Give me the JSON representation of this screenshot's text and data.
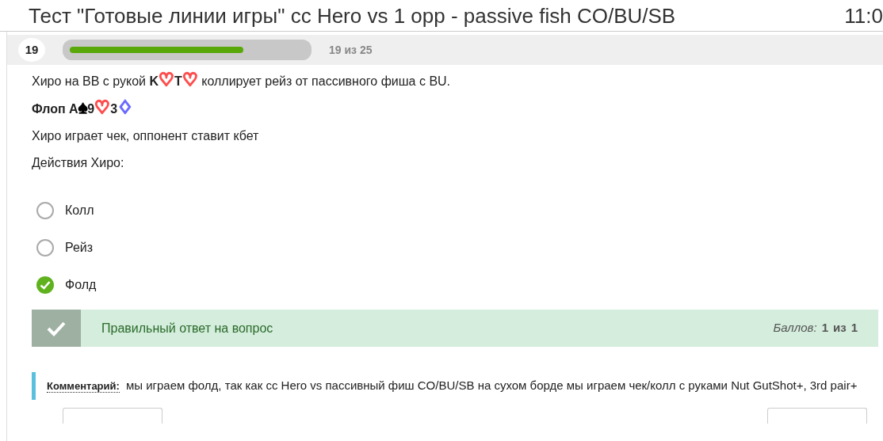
{
  "header": {
    "title": "Тест \"Готовые линии игры\" cc Hero vs 1 opp - passive fish CO/BU/SB",
    "time": "11:0"
  },
  "progress": {
    "number": "19",
    "level": 0.74,
    "label": "19 из 25"
  },
  "question": [
    [
      {
        "text": "Хиро на BB с рукой "
      },
      {
        "text": "K",
        "bold": true
      },
      {
        "text": "♡",
        "color": "#ff4d4d"
      },
      {
        "text": "T",
        "bold": true
      },
      {
        "text": "♡",
        "color": "#ff4d4d"
      },
      {
        "text": " коллирует рейз от пассивного фиша с BU."
      }
    ],
    [
      {
        "text": "Флоп A",
        "bold": true
      },
      {
        "text": "♠",
        "color": "#000000"
      },
      {
        "text": "9",
        "bold": true
      },
      {
        "text": "♡",
        "color": "#ff4d4d"
      },
      {
        "text": "3",
        "bold": true
      },
      {
        "text": "♢",
        "color": "#6a6aff"
      }
    ],
    [
      {
        "text": "Хиро играет чек, оппонент ставит кбет"
      }
    ],
    [
      {
        "text": "Действия Хиро:"
      }
    ]
  ],
  "options": [
    {
      "label": "Колл",
      "selected": false
    },
    {
      "label": "Рейз",
      "selected": false
    },
    {
      "label": "Фолд",
      "selected": true
    }
  ],
  "result": {
    "correct": true,
    "message": "Правильный ответ на вопрос",
    "score_label": "Баллов:",
    "score": "1",
    "of": "из",
    "max": "1"
  },
  "comment": {
    "label": "Комментарий:",
    "text": "мы играем фолд, так как cc Hero vs пассивный фиш CO/BU/SB на сухом борде мы играем чек/колл с руками Nut GutShot+, 3rd pair+"
  }
}
